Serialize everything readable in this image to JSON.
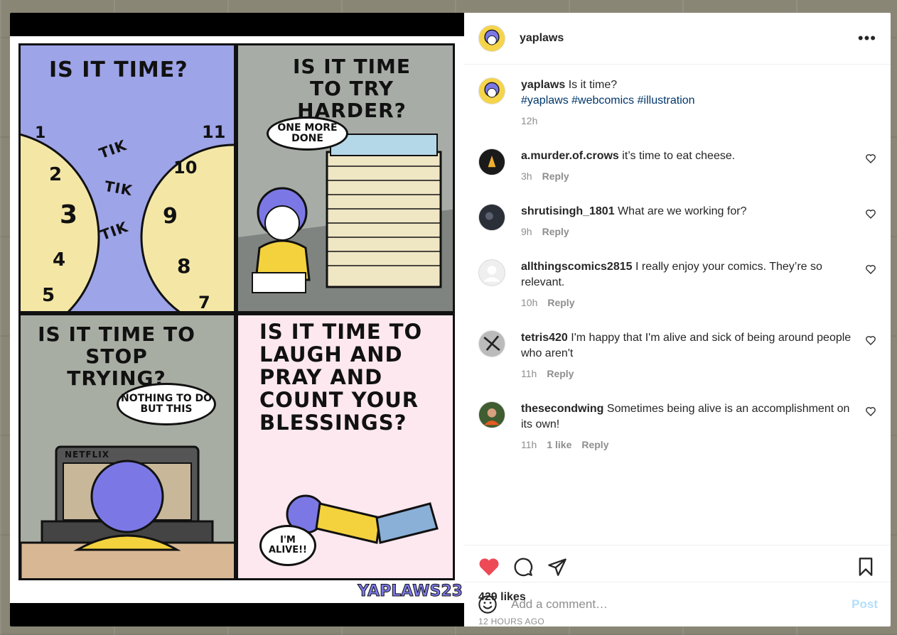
{
  "post": {
    "author": "yaplaws",
    "caption": "Is it time?",
    "hashtags": "#yaplaws #webcomics #illustration",
    "age": "12h",
    "likes": "429 likes",
    "posted_ago": "12 HOURS AGO"
  },
  "comic": {
    "panel1_caption": "IS IT TIME?",
    "panel1_sfx": [
      "TIK",
      "TIK",
      "TIK"
    ],
    "panel2_caption": "IS IT TIME TO TRY HARDER?",
    "panel2_bubble": "ONE MORE DONE",
    "panel3_caption": "IS IT TIME TO STOP TRYING?",
    "panel3_bubble": "NOTHING TO DO BUT THIS",
    "panel3_tv": "NETFLIX",
    "panel4_caption": "IS IT TIME TO LAUGH AND PRAY AND COUNT YOUR BLESSINGS?",
    "panel4_bubble": "I'M ALIVE!!",
    "signature": "YAPLAWS23"
  },
  "comments": [
    {
      "user": "a.murder.of.crows",
      "text": "it’s time to eat cheese.",
      "age": "3h",
      "likes": "",
      "reply": "Reply"
    },
    {
      "user": "shrutisingh_1801",
      "text": "What are we working for?",
      "age": "9h",
      "likes": "",
      "reply": "Reply"
    },
    {
      "user": "allthingscomics2815",
      "text": "I really enjoy your comics. They’re so relevant.",
      "age": "10h",
      "likes": "",
      "reply": "Reply"
    },
    {
      "user": "tetris420",
      "text": "I'm happy that I'm alive and sick of being around people who aren't",
      "age": "11h",
      "likes": "",
      "reply": "Reply"
    },
    {
      "user": "thesecondwing",
      "text": "Sometimes being alive is an accomplishment on its own!",
      "age": "11h",
      "likes": "1 like",
      "reply": "Reply"
    }
  ],
  "composer": {
    "placeholder": "Add a comment…",
    "post_label": "Post"
  },
  "icons": {
    "more": "more-options-icon",
    "like": "heart-filled-icon",
    "comment": "comment-icon",
    "share": "send-icon",
    "save": "bookmark-icon",
    "emoji": "emoji-icon"
  },
  "colors": {
    "like_red": "#ed4956",
    "link_blue": "#00376b",
    "post_disabled": "#b2dffc"
  },
  "more_glyph": "•••"
}
